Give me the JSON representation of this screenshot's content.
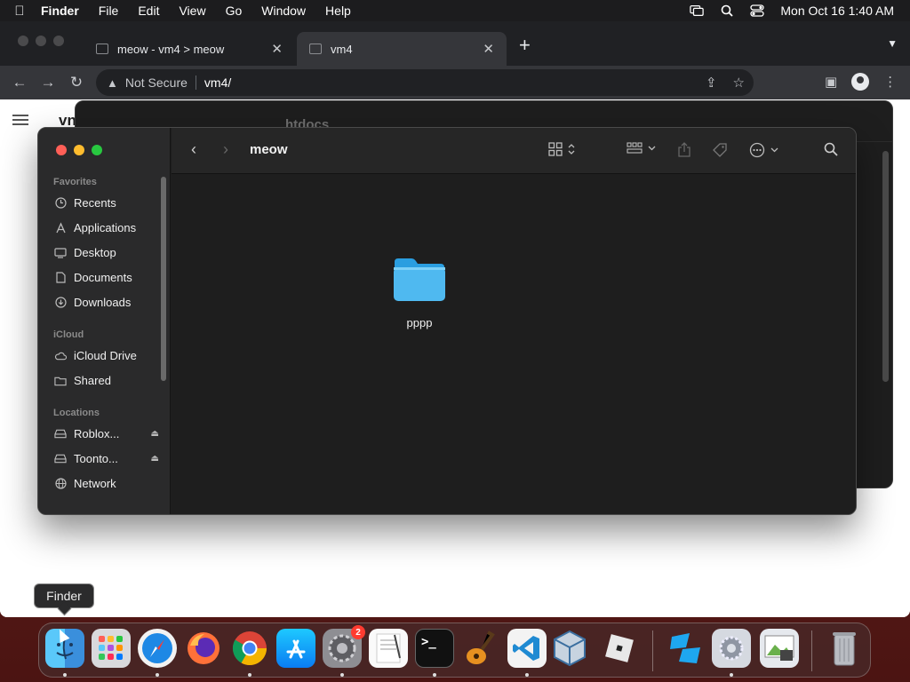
{
  "menubar": {
    "app": "Finder",
    "items": [
      "File",
      "Edit",
      "View",
      "Go",
      "Window",
      "Help"
    ],
    "datetime": "Mon Oct 16  1:40 AM"
  },
  "browser": {
    "tabs": [
      {
        "title": "meow - vm4 > meow",
        "active": false
      },
      {
        "title": "vm4",
        "active": true
      }
    ],
    "security_label": "Not Secure",
    "url": "vm4/",
    "page_header_partial": "vn"
  },
  "finder_back": {
    "title_partial": "htdocs"
  },
  "finder": {
    "title": "meow",
    "sidebar": {
      "sections": [
        {
          "label": "Favorites",
          "items": [
            {
              "label": "Recents",
              "icon": "clock-icon"
            },
            {
              "label": "Applications",
              "icon": "applications-icon"
            },
            {
              "label": "Desktop",
              "icon": "desktop-icon"
            },
            {
              "label": "Documents",
              "icon": "document-icon"
            },
            {
              "label": "Downloads",
              "icon": "download-icon"
            }
          ]
        },
        {
          "label": "iCloud",
          "items": [
            {
              "label": "iCloud Drive",
              "icon": "cloud-icon"
            },
            {
              "label": "Shared",
              "icon": "shared-folder-icon"
            }
          ]
        },
        {
          "label": "Locations",
          "items": [
            {
              "label": "Roblox...",
              "icon": "disk-icon"
            },
            {
              "label": "Toonto...",
              "icon": "disk-icon"
            },
            {
              "label": "Network",
              "icon": "network-icon"
            }
          ]
        }
      ]
    },
    "items": [
      {
        "name": "pppp",
        "type": "folder"
      }
    ]
  },
  "tooltip": "Finder",
  "dock": {
    "apps": [
      "Finder",
      "Launchpad",
      "Safari",
      "Firefox",
      "Chrome",
      "App Store",
      "System Settings",
      "TextEdit",
      "Terminal",
      "GarageBand",
      "Visual Studio Code",
      "VirtualBox",
      "Roblox",
      "Roblox Studio",
      "Utility",
      "Preview",
      "Trash"
    ],
    "settings_badge": "2"
  },
  "colors": {
    "finder_bg": "#1e1e1e",
    "sidebar_bg": "#2a2a2b",
    "folder_blue": "#4fb9f0",
    "close": "#ff5f57",
    "minimize": "#febc2e",
    "zoom": "#28c840"
  }
}
